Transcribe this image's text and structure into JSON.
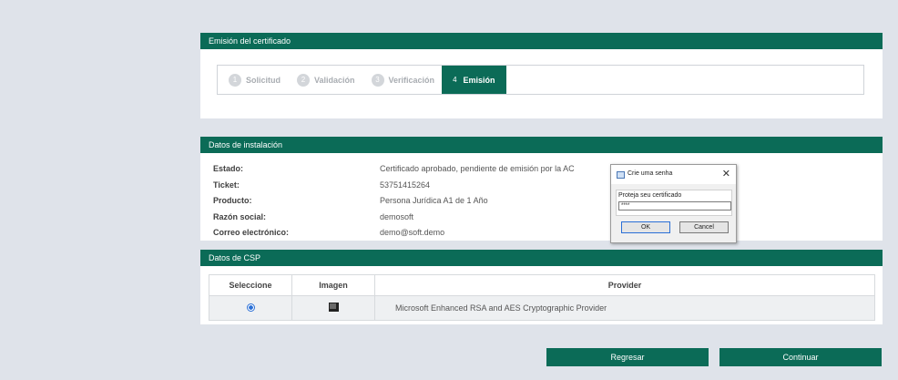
{
  "emision": {
    "header": "Emisión del certificado",
    "steps": [
      {
        "num": "1",
        "label": "Solicitud"
      },
      {
        "num": "2",
        "label": "Validación"
      },
      {
        "num": "3",
        "label": "Verificación"
      },
      {
        "num": "4",
        "label": "Emisión",
        "active": true
      }
    ]
  },
  "instalacion": {
    "header": "Datos de instalación",
    "rows": [
      {
        "label": "Estado:",
        "value": "Certificado aprobado, pendiente de emisión por la AC"
      },
      {
        "label": "Ticket:",
        "value": "53751415264"
      },
      {
        "label": "Producto:",
        "value": "Persona Jurídica A1 de 1 Año"
      },
      {
        "label": "Razón social:",
        "value": "demosoft"
      },
      {
        "label": "Correo electrónico:",
        "value": "demo@soft.demo"
      }
    ]
  },
  "dialog": {
    "title": "Crie uma senha",
    "close": "✕",
    "group_label": "Proteja seu certificado",
    "password_value": "****",
    "ok_label": "OK",
    "cancel_label": "Cancel"
  },
  "csp": {
    "header": "Datos de CSP",
    "columns": [
      "Seleccione",
      "Imagen",
      "Provider"
    ],
    "rows": [
      {
        "selected": true,
        "icon": "computer-icon",
        "provider": "Microsoft Enhanced RSA and AES Cryptographic Provider"
      }
    ]
  },
  "actions": {
    "back_label": "Regresar",
    "continue_label": "Continuar"
  },
  "colors": {
    "brand": "#0b6b57",
    "background": "#dfe3ea"
  }
}
